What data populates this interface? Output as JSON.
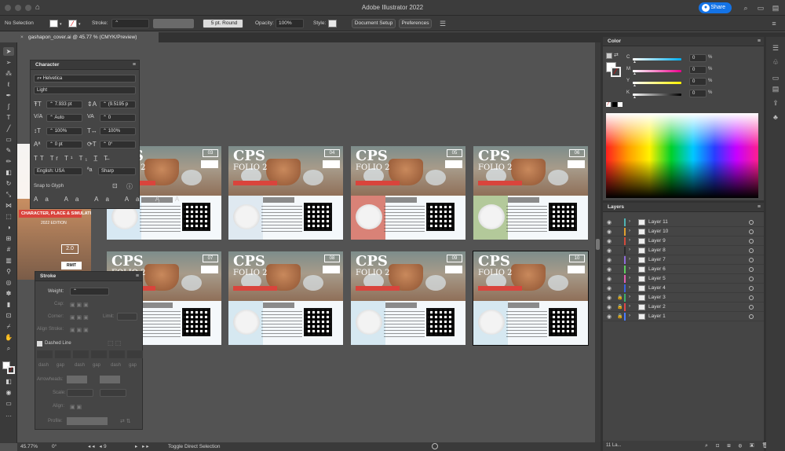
{
  "window": {
    "title": "Adobe Illustrator 2022",
    "share_label": "Share"
  },
  "control_bar": {
    "selection": "No Selection",
    "stroke_label": "Stroke:",
    "brush": "5 pt. Round",
    "opacity_label": "Opacity:",
    "opacity": "100%",
    "style_label": "Style:",
    "document_setup": "Document Setup",
    "preferences": "Preferences"
  },
  "document_tab": {
    "label": "gashapon_cover.ai @ 45.77 % (CMYK/Preview)"
  },
  "character_panel": {
    "title": "Character",
    "font_family": "Helvetica",
    "font_style": "Light",
    "font_size": "7.933 pt",
    "leading": "(9.5195 p",
    "kerning": "Auto",
    "tracking": "0",
    "vertical_scale": "100%",
    "horizontal_scale": "100%",
    "baseline_shift": "0 pt",
    "rotation": "0°",
    "language": "English: USA",
    "antialias": "Sharp",
    "snap_to_glyph": "Snap to Glyph"
  },
  "stroke_panel": {
    "title": "Stroke",
    "weight_label": "Weight:",
    "cap_label": "Cap:",
    "corner_label": "Corner:",
    "limit_label": "Limit:",
    "align_stroke_label": "Align Stroke:",
    "dashed_line_label": "Dashed Line",
    "dash_labels": [
      "dash",
      "gap",
      "dash",
      "gap",
      "dash",
      "gap"
    ],
    "arrowheads_label": "Arrowheads:",
    "scale_label": "Scale:",
    "align_label": "Align:",
    "profile_label": "Profile:"
  },
  "color_panel": {
    "title": "Color",
    "channels": [
      {
        "name": "C",
        "value": "0",
        "unit": "%",
        "gradient": [
          "#ffffff",
          "#00aeef"
        ]
      },
      {
        "name": "M",
        "value": "0",
        "unit": "%",
        "gradient": [
          "#ffffff",
          "#ec008c"
        ]
      },
      {
        "name": "Y",
        "value": "0",
        "unit": "%",
        "gradient": [
          "#ffffff",
          "#fff200"
        ]
      },
      {
        "name": "K",
        "value": "0",
        "unit": "%",
        "gradient": [
          "#ffffff",
          "#000000"
        ]
      }
    ]
  },
  "layers_panel": {
    "title": "Layers",
    "layers": [
      {
        "name": "Layer 11",
        "color": "#4fb3b3",
        "locked": false
      },
      {
        "name": "Layer 10",
        "color": "#e0a030",
        "locked": false
      },
      {
        "name": "Layer 9",
        "color": "#d24b3c",
        "locked": false
      },
      {
        "name": "Layer 8",
        "color": "#2b2b2b",
        "locked": false
      },
      {
        "name": "Layer 7",
        "color": "#8f6bd9",
        "locked": false
      },
      {
        "name": "Layer 6",
        "color": "#5fcf5f",
        "locked": false
      },
      {
        "name": "Layer 5",
        "color": "#e35fb0",
        "locked": false
      },
      {
        "name": "Layer 4",
        "color": "#3a62e0",
        "locked": false
      },
      {
        "name": "Layer 3",
        "color": "#3fb06a",
        "locked": true
      },
      {
        "name": "Layer 2",
        "color": "#e04848",
        "locked": true
      },
      {
        "name": "Layer 1",
        "color": "#4a7bff",
        "locked": true
      }
    ],
    "footer": "11 La..."
  },
  "artboards": [
    {
      "cps": "CPS",
      "folio": "FOLIO 2",
      "num": "03",
      "tag_color": "#d7e8f3"
    },
    {
      "cps": "CPS",
      "folio": "FOLIO 2",
      "num": "04",
      "tag_color": "#dfe9f1"
    },
    {
      "cps": "CPS",
      "folio": "FOLIO 2",
      "num": "05",
      "tag_color": "#d98277"
    },
    {
      "cps": "CPS",
      "folio": "FOLIO 2",
      "num": "06",
      "tag_color": "#b3c99a"
    },
    {
      "cps": "CPS",
      "folio": "FOLIO 2",
      "num": "07",
      "tag_color": "#9ccfd0"
    },
    {
      "cps": "CPS",
      "folio": "FOLIO 2",
      "num": "08",
      "tag_color": "#d6e8f1"
    },
    {
      "cps": "CPS",
      "folio": "FOLIO 2",
      "num": "09",
      "tag_color": "#d6e8f1"
    },
    {
      "cps": "CPS",
      "folio": "FOLIO 2",
      "num": "10",
      "tag_color": "#d6e8f1"
    }
  ],
  "left_artboard": {
    "band": "CHARACTER, PLACE & SIMULATION",
    "edition": "2022 EDITION",
    "num": "2.0"
  },
  "status_bar": {
    "zoom": "45.77%",
    "angle": "0°",
    "page": "9",
    "tool": "Toggle Direct Selection"
  }
}
